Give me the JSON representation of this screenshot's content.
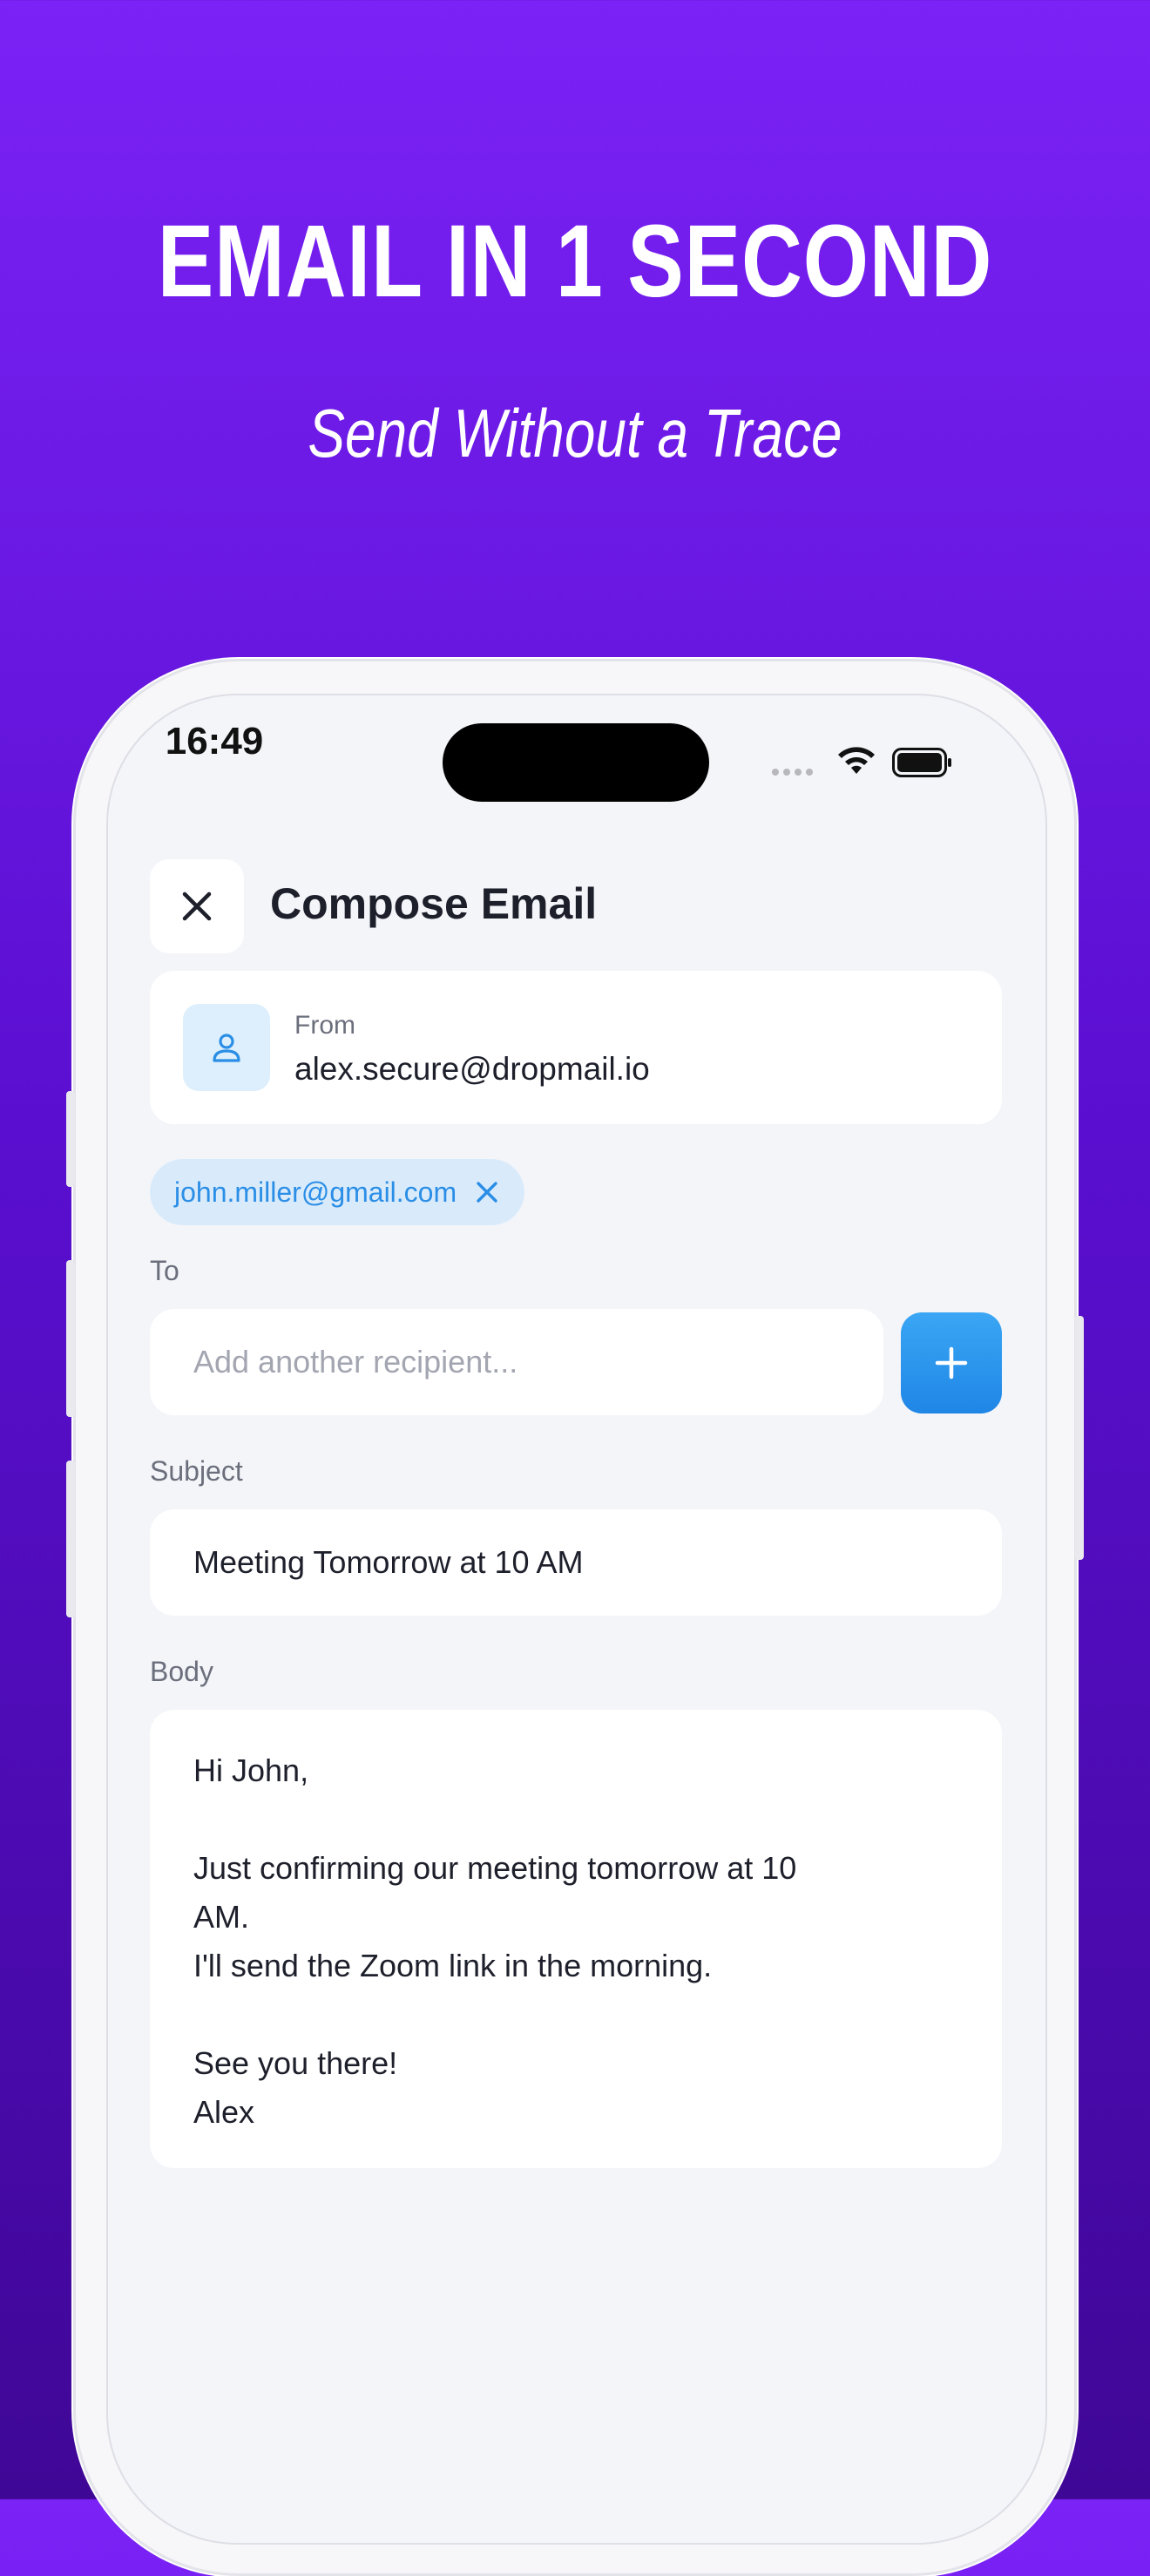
{
  "promo": {
    "headline": "EMAIL IN 1 SECOND",
    "subheadline": "Send Without a Trace"
  },
  "status_bar": {
    "time": "16:49"
  },
  "compose": {
    "title": "Compose Email",
    "from_label": "From",
    "from_value": "alex.secure@dropmail.io",
    "recipients": [
      "john.miller@gmail.com"
    ],
    "to_label": "To",
    "to_placeholder": "Add another recipient...",
    "subject_label": "Subject",
    "subject_value": "Meeting Tomorrow at 10 AM",
    "body_label": "Body",
    "body_lines": [
      "Hi John,",
      "",
      "Just confirming our meeting tomorrow at 10",
      "AM.",
      "I'll send the Zoom link in the morning.",
      "",
      "See you there!",
      "Alex"
    ]
  },
  "icons": {
    "close": "close-icon",
    "user": "user-icon",
    "chip_remove": "close-icon",
    "add": "plus-icon",
    "wifi": "wifi-icon",
    "battery": "battery-icon"
  },
  "colors": {
    "accent": "#2b8ee6",
    "background_top": "#7b22f6",
    "background_bottom": "#3f0796"
  }
}
